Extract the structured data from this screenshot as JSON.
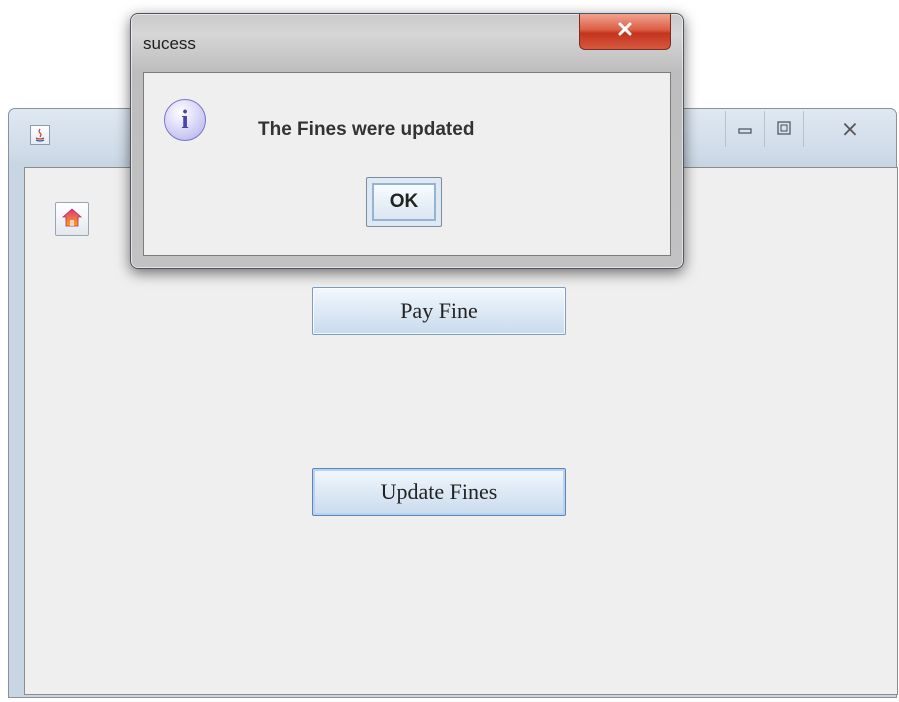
{
  "main_window": {
    "controls": {
      "minimize_icon": "minimize-icon",
      "maximize_icon": "maximize-icon",
      "close_icon": "close-icon",
      "close_glyph": "⨯"
    },
    "home_icon": "home-icon",
    "buttons": {
      "pay_fine": "Pay Fine",
      "update_fines": "Update Fines"
    }
  },
  "dialog": {
    "title": "sucess",
    "icon": "info-icon",
    "icon_glyph": "i",
    "message": "The Fines were updated",
    "ok_label": "OK"
  },
  "colors": {
    "dialog_close": "#d6593d",
    "button_fill": "#dde9f5",
    "content_bg": "#efefef"
  }
}
